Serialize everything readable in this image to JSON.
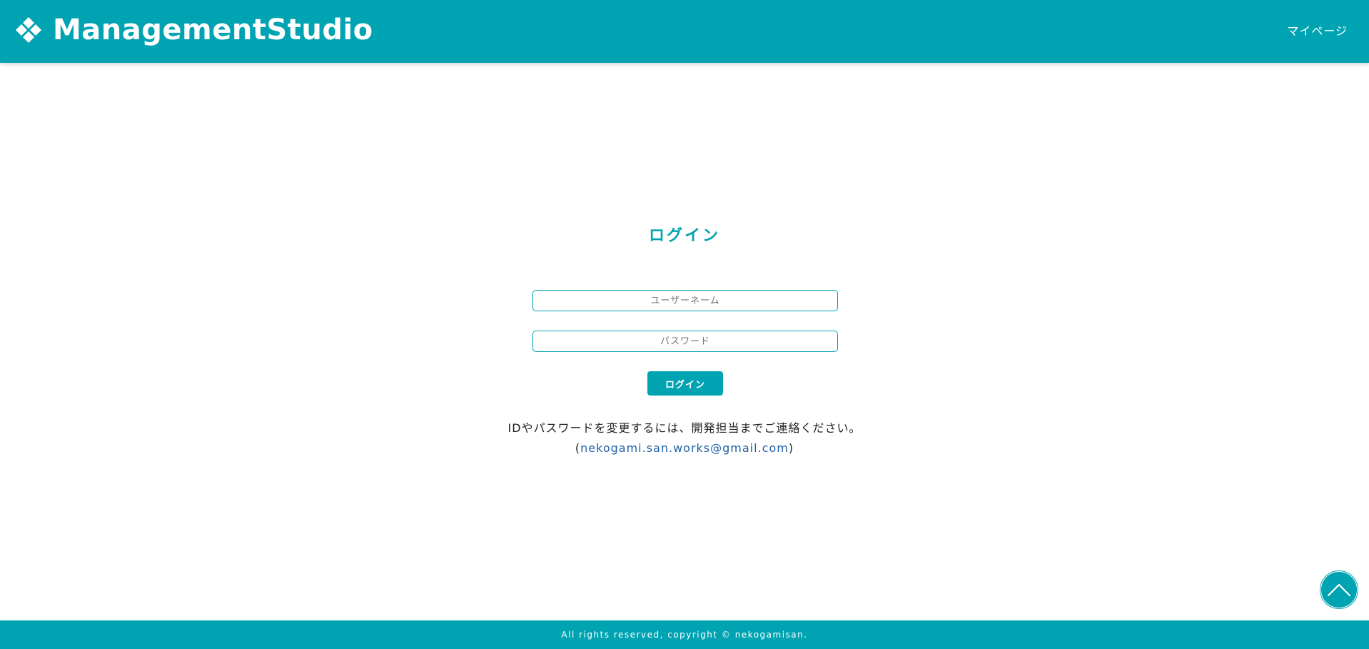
{
  "header": {
    "title": "ManagementStudio",
    "logo_icon": "diamond-cluster-icon",
    "mypage_label": "マイページ"
  },
  "login": {
    "title": "ログイン",
    "username_placeholder": "ユーザーネーム",
    "password_placeholder": "パスワード",
    "button_label": "ログイン"
  },
  "notice": {
    "message": "IDやパスワードを変更するには、開発担当までご連絡ください。",
    "contact_open": "(",
    "contact_email": "nekogami.san.works@gmail.com",
    "contact_close": ")"
  },
  "scroll_top": {
    "icon": "chevron-up-icon"
  },
  "footer": {
    "copyright": "All rights reserved, copyright © nekogamisan."
  },
  "colors": {
    "brand": "#00a3b2",
    "link": "#1f5fa8",
    "text": "#222222",
    "background": "#ffffff"
  }
}
